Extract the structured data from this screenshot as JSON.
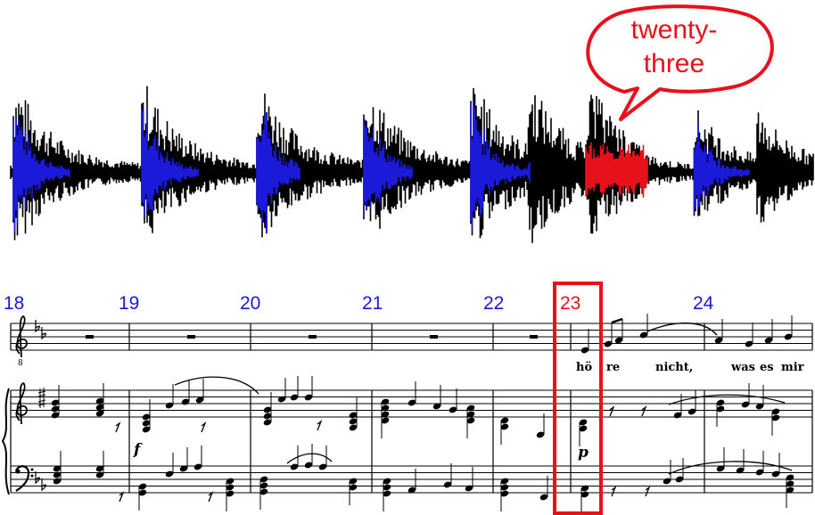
{
  "speech_bubble": {
    "line1": "twenty-",
    "line2": "three",
    "color": "#e8111b"
  },
  "waveform": {
    "base_color": "#000000",
    "highlight_color": "#1a1ad8",
    "selected_color": "#e8111b"
  },
  "measures": [
    {
      "number": "18"
    },
    {
      "number": "19"
    },
    {
      "number": "20"
    },
    {
      "number": "21"
    },
    {
      "number": "22"
    },
    {
      "number": "23",
      "highlighted": true
    },
    {
      "number": "24"
    }
  ],
  "lyrics": [
    "hö",
    "re",
    "nicht,",
    "was",
    "es",
    "mir"
  ],
  "dynamics": {
    "forte": "f",
    "piano": "p"
  }
}
